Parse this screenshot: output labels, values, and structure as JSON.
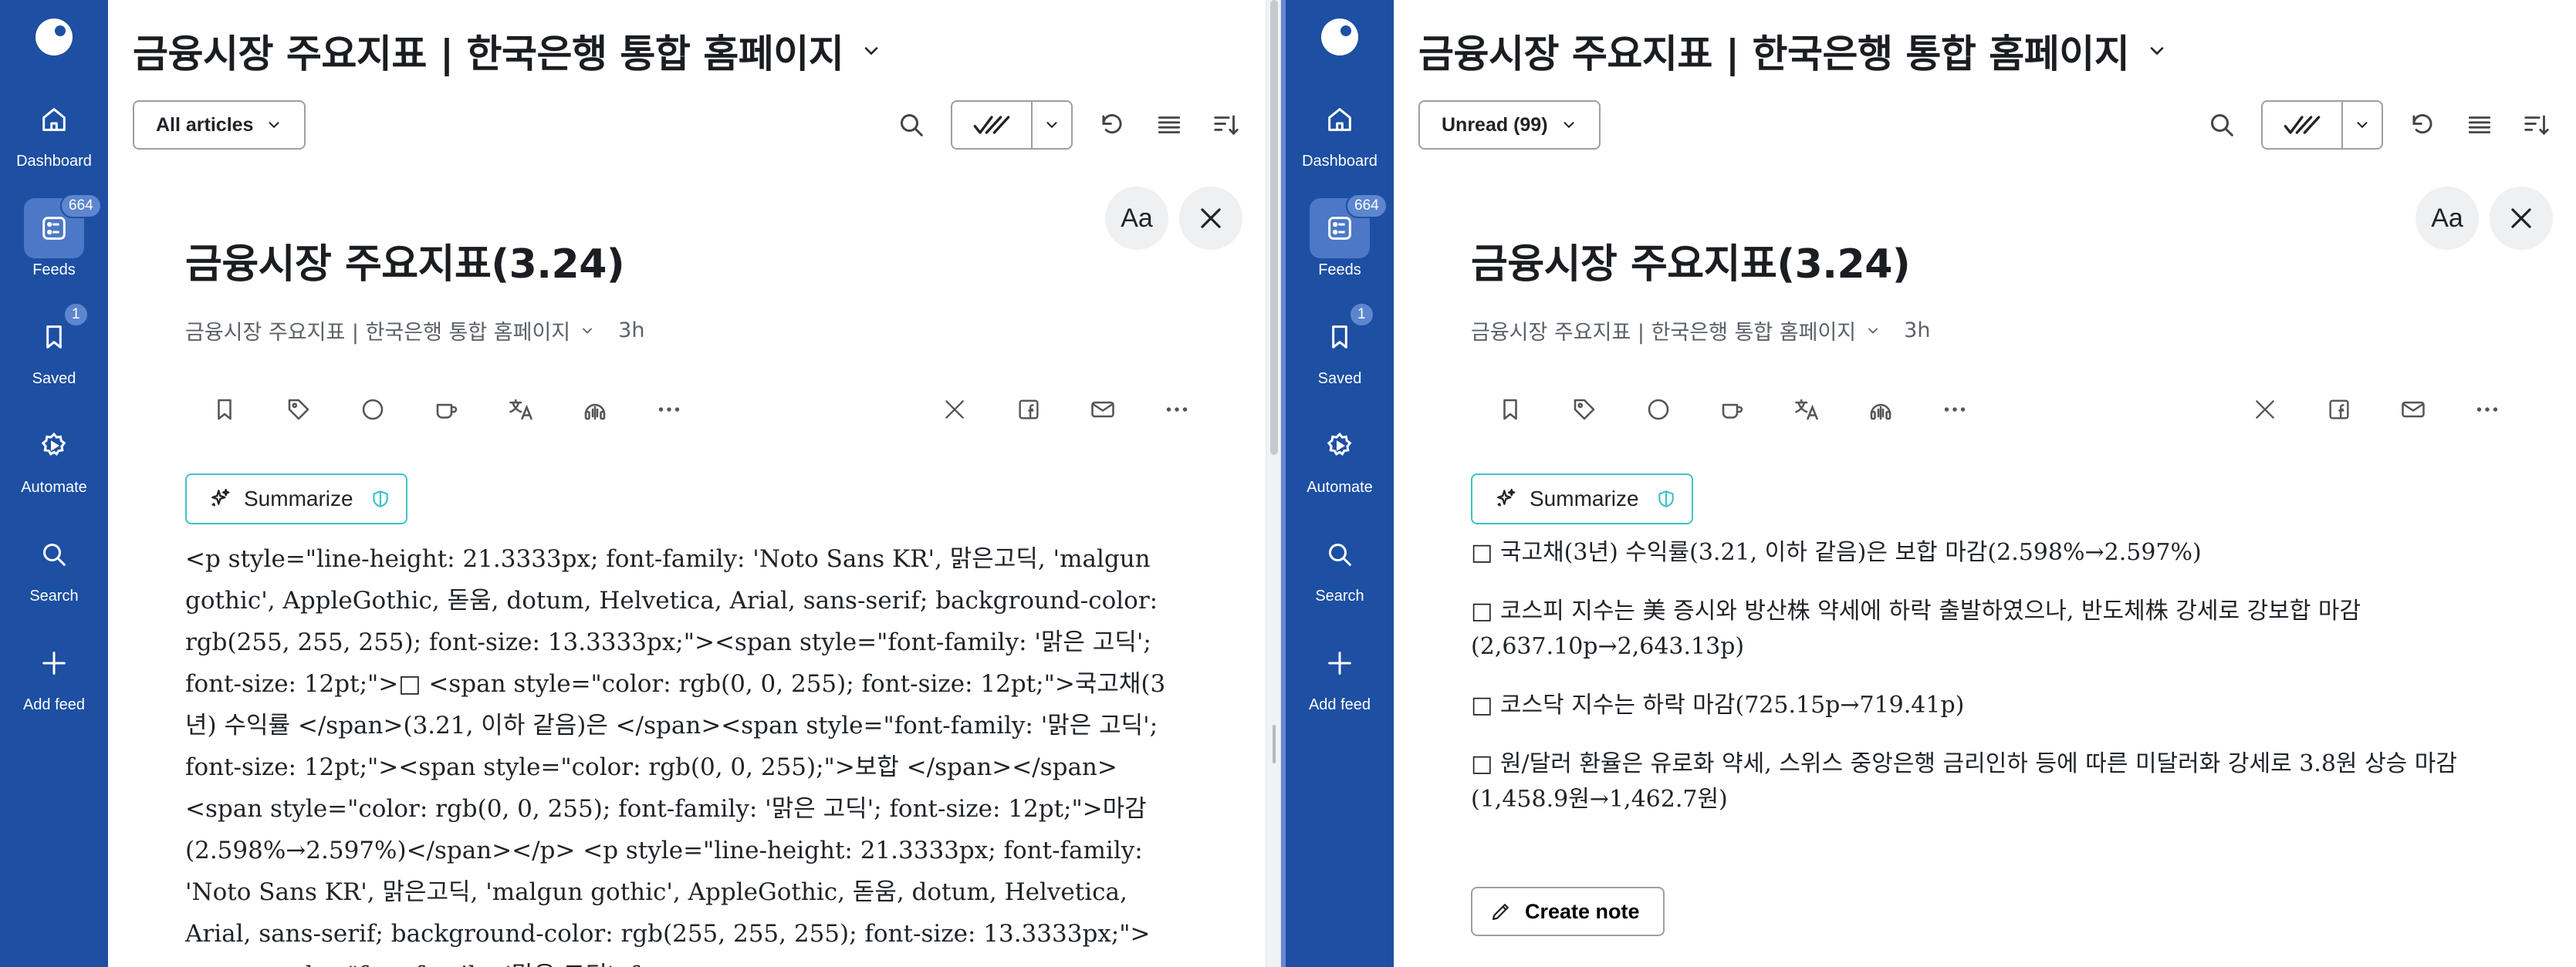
{
  "sidebar": {
    "items": [
      {
        "label": "Dashboard",
        "icon": "home-icon"
      },
      {
        "label": "Feeds",
        "icon": "feeds-icon",
        "badge": "664"
      },
      {
        "label": "Saved",
        "icon": "bookmark-icon",
        "badge": "1"
      },
      {
        "label": "Automate",
        "icon": "automate-icon"
      },
      {
        "label": "Search",
        "icon": "search-icon"
      },
      {
        "label": "Add feed",
        "icon": "plus-icon"
      }
    ]
  },
  "left": {
    "feed_title": "금융시장 주요지표 | 한국은행 통합 홈페이지",
    "filter_label": "All articles",
    "article": {
      "title": "금융시장 주요지표(3.24)",
      "source": "금융시장 주요지표 | 한국은행 통합 홈페이지",
      "age": "3h",
      "summarize_label": "Summarize",
      "raw_html": "<p style=\"line-height: 21.3333px; font-family: 'Noto Sans KR', 맑은고딕, 'malgun gothic', AppleGothic, 돋움, dotum, Helvetica, Arial, sans-serif; background-color: rgb(255, 255, 255); font-size: 13.3333px;\"><span style=\"font-family: '맑은 고딕'; font-size: 12pt;\">□ <span style=\"color: rgb(0, 0, 255); font-size: 12pt;\">국고채(3년) 수익률 </span>(3.21, 이하 같음)은 </span><span style=\"font-family: '맑은 고딕'; font-size: 12pt;\"><span style=\"color: rgb(0, 0, 255);\">보합 </span></span><span style=\"color: rgb(0, 0, 255); font-family: '맑은 고딕'; font-size: 12pt;\">마감(2.598%→2.597%)</span></p> <p style=\"line-height: 21.3333px; font-family: 'Noto Sans KR', 맑은고딕, 'malgun gothic', AppleGothic, 돋움, dotum, Helvetica, Arial, sans-serif; background-color: rgb(255, 255, 255); font-size: 13.3333px;\"><span style=\"font-family: '맑은 고딕'; font-"
    }
  },
  "right": {
    "feed_title": "금융시장 주요지표 | 한국은행 통합 홈페이지",
    "filter_label": "Unread (99)",
    "article": {
      "title": "금융시장 주요지표(3.24)",
      "source": "금융시장 주요지표 | 한국은행 통합 홈페이지",
      "age": "3h",
      "summarize_label": "Summarize",
      "paragraphs": [
        "□ 국고채(3년) 수익률(3.21, 이하 같음)은 보합 마감(2.598%→2.597%)",
        "□ 코스피 지수는 美 증시와 방산株 약세에 하락 출발하였으나, 반도체株 강세로 강보합 마감(2,637.10p→2,643.13p)",
        "□ 코스닥 지수는 하락 마감(725.15p→719.41p)",
        "□ 원/달러 환율은 유로화 약세, 스위스 중앙은행 금리인하 등에 따른 미달러화 강세로 3.8원 상승 마감(1,458.9원→1,462.7원)"
      ],
      "create_note_label": "Create note"
    }
  },
  "reader_font_label": "Aa",
  "colors": {
    "sidebar_bg": "#1d4fa3",
    "sidebar_active": "#4c78c7",
    "summarize_border": "#3ec3c8"
  }
}
